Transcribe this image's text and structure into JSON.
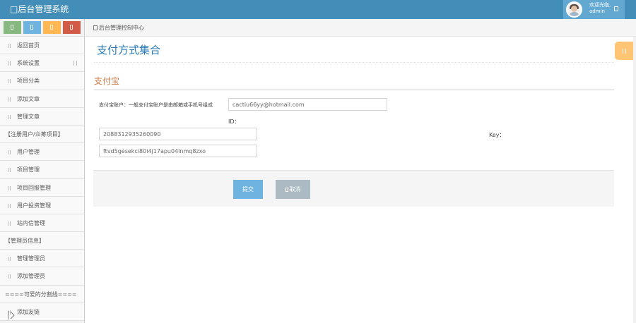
{
  "header": {
    "brand": "□后台管理系统",
    "user": {
      "welcome": "欢迎光临,",
      "name": "admin"
    }
  },
  "shortcuts": [
    {
      "color": "#87b87f",
      "icon": "signal-icon"
    },
    {
      "color": "#6fb3e0",
      "icon": "pencil-icon"
    },
    {
      "color": "#ffb752",
      "icon": "group-icon"
    },
    {
      "color": "#d15b47",
      "icon": "cogs-icon"
    }
  ],
  "sidebar": {
    "items": [
      {
        "label": "返回首页"
      },
      {
        "label": "系统设置"
      },
      {
        "label": "项目分类"
      },
      {
        "label": "添加文章"
      },
      {
        "label": "管理文章"
      },
      {
        "label": "【注册用户/众筹项目】"
      },
      {
        "label": "用户管理"
      },
      {
        "label": "项目管理"
      },
      {
        "label": "项目回报管理"
      },
      {
        "label": "用户投资管理"
      },
      {
        "label": "站内信管理"
      },
      {
        "label": "【管理员信息】"
      },
      {
        "label": "管理管理员"
      },
      {
        "label": "添加管理员"
      },
      {
        "label": "====可爱的分割线===="
      },
      {
        "label": "添加友链"
      }
    ]
  },
  "breadcrumb": {
    "text": "后台管理控制中心"
  },
  "page": {
    "title": "支付方式集合"
  },
  "alipay": {
    "section_title": "支付宝",
    "account_label": "支付宝账户：一般支付宝账户是由邮箱或手机号组成",
    "account_value": "cactiu66yy@hotmail.com",
    "id_label": "ID：",
    "id_value": "2088312935260090",
    "key_label": "Key：",
    "key_value": "ftvd5gesekci80i4j17apu04lnmq8zxo"
  },
  "actions": {
    "submit": "提交",
    "cancel": "取消"
  }
}
